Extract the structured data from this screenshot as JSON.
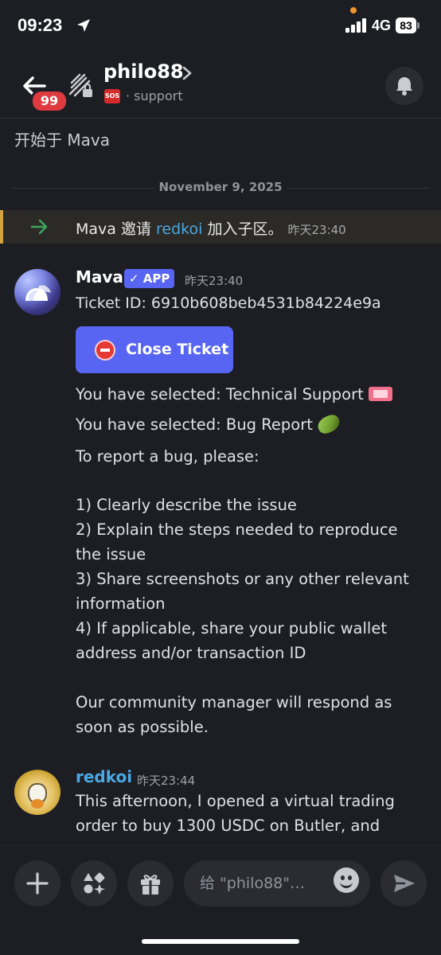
{
  "status_bar": {
    "time": "09:23",
    "network": "4G",
    "battery": "83"
  },
  "header": {
    "unread_badge": "99",
    "channel_name": "philo88",
    "sos_label": "SOS",
    "subtitle": "· support"
  },
  "thread": {
    "started_text": "开始于 Mava",
    "date_divider": "November 9, 2025"
  },
  "system_message": {
    "actor": "Mava",
    "verb": " 邀请 ",
    "mention": "redkoi",
    "action": " 加入子区。",
    "time": "昨天23:40"
  },
  "messages": [
    {
      "author": "Mava",
      "tag": "✓ APP",
      "time": "昨天23:40",
      "ticket_id": "Ticket ID: 6910b608beb4531b84224e9a",
      "button_label": "Close Ticket",
      "lines": [
        "You have selected: Technical Support",
        "You have selected: Bug Report",
        "To report a bug, please:",
        "1) Clearly describe the issue",
        "2) Explain the steps needed to reproduce",
        "the issue",
        "3) Share screenshots or any other relevant",
        "information",
        "4) If applicable, share your public wallet",
        "address and/or transaction ID",
        "Our community manager will respond as",
        "soon as possible."
      ]
    },
    {
      "author": "redkoi",
      "time": "昨天23:44",
      "lines": [
        "This afternoon, I opened a virtual trading",
        "order to buy 1300 USDC on Butler, and"
      ]
    }
  ],
  "composer": {
    "placeholder": "给 \"philo88\"…"
  },
  "colors": {
    "background": "#1d1e23",
    "blurple": "#5865f2",
    "mention": "#4aa8e4",
    "badge_red": "#e03a41",
    "system_bar": "#d4a23f"
  },
  "icons": [
    "location-arrow-icon",
    "back-arrow-icon",
    "thread-icon",
    "chevron-right-icon",
    "bell-icon",
    "join-arrow-icon",
    "stop-sign-icon",
    "ticket-icon",
    "bug-icon",
    "plus-icon",
    "apps-icon",
    "gift-icon",
    "emoji-icon",
    "send-icon"
  ]
}
